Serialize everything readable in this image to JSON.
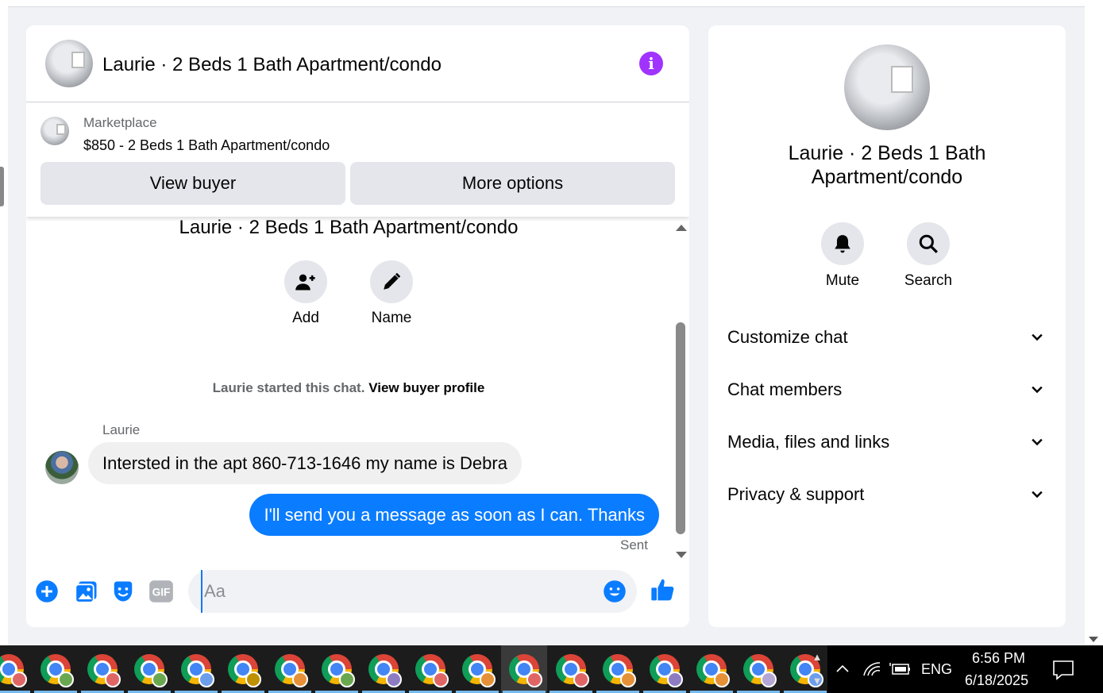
{
  "header": {
    "title": "Laurie · 2 Beds 1 Bath Apartment/condo",
    "info_glyph": "i"
  },
  "marketplace": {
    "label": "Marketplace",
    "listing": "$850 - 2 Beds 1 Bath Apartment/condo",
    "view_buyer": "View buyer",
    "more_options": "More options"
  },
  "conversation": {
    "title": "Laurie · 2 Beds 1 Bath Apartment/condo",
    "add_label": "Add",
    "name_label": "Name",
    "started_text": "Laurie started this chat.",
    "view_profile": "View buyer profile",
    "sender": "Laurie",
    "incoming": "Intersted in the apt 860-713-1646 my name is  Debra",
    "outgoing": "I'll send you a message as soon as I can. Thanks",
    "status": "Sent"
  },
  "composer": {
    "placeholder": "Aa",
    "gif_label": "GIF"
  },
  "info_panel": {
    "title": "Laurie · 2 Beds 1 Bath Apartment/condo",
    "mute": "Mute",
    "search": "Search",
    "sections": [
      "Customize chat",
      "Chat members",
      "Media, files and links",
      "Privacy & support"
    ]
  },
  "taskbar": {
    "language": "ENG",
    "time": "6:56 PM",
    "date": "6/18/2025",
    "profile_colors": [
      "#e06666",
      "#6aa84f",
      "#e06666",
      "#6aa84f",
      "#6d9eeb",
      "#bf9000",
      "#e69138",
      "#6aa84f",
      "#8e7cc3",
      "#e06666",
      "#e69138",
      "#e06666",
      "#e06666",
      "#e69138",
      "#8e7cc3",
      "#e69138",
      "#b4a7d6",
      "#6d9eeb"
    ]
  },
  "colors": {
    "accent": "#0a7cff",
    "info": "#a033ff",
    "composer_icons": "#0a7cff"
  }
}
